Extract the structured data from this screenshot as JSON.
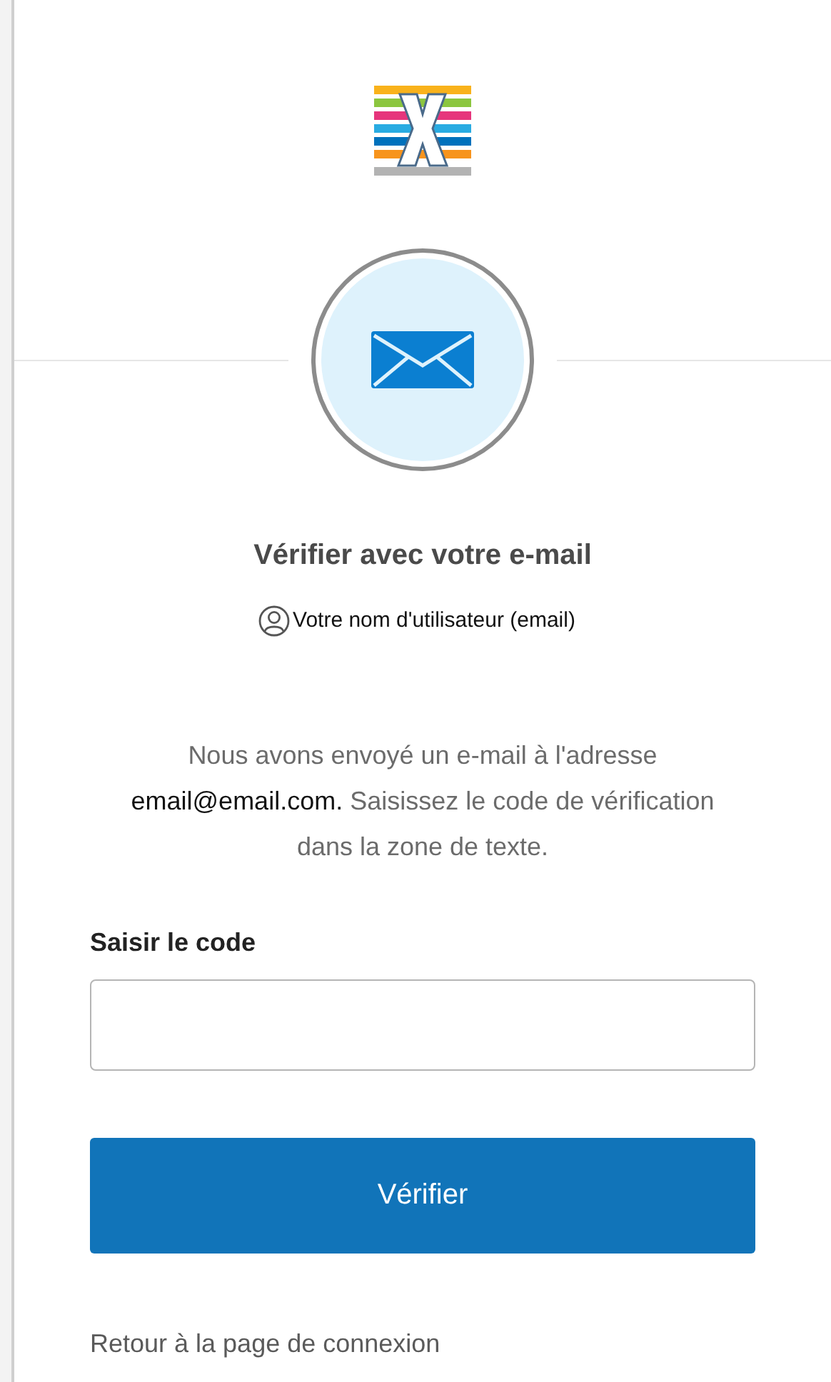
{
  "title": "Vérifier avec votre e-mail",
  "username": "Votre nom d'utilisateur (email)",
  "message": {
    "before": "Nous avons envoyé un e-mail à l'adresse",
    "email": "email@email.com.",
    "after": "Saisissez le code de vérification dans la zone de texte."
  },
  "code_field": {
    "label": "Saisir le code"
  },
  "verify_button": "Vérifier",
  "back_link": "Retour à la page de connexion"
}
